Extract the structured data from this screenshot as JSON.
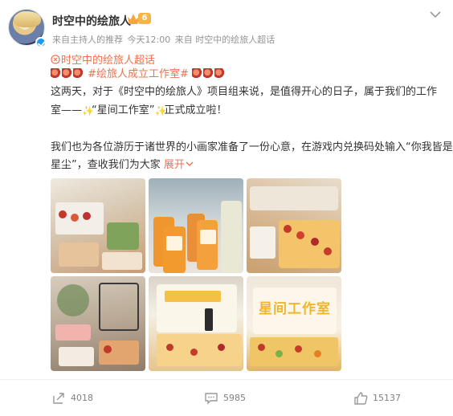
{
  "post": {
    "author": "时空中的绘旅人",
    "vip_level": "6",
    "meta": {
      "source": "来自主持人的推荐",
      "time": "今天12:00",
      "via": "来自 时空中的绘旅人超话"
    },
    "supertopic": "时空中的绘旅人超话",
    "hashtag": "#绘旅人成立工作室#",
    "lines": {
      "l1_a": "这两天，对于《时空中的绘旅人》项目组来说，是值得开心的日子，属于我们的工作",
      "l2_a": "室——",
      "l2_b": "“星间工作室”",
      "l2_c": "正式成立啦！",
      "l3": "我们也为各位游历于诸世界的小画家准备了一份心意，在游戏内兑换码处输入“你我皆是",
      "l4_a": "星尘”，查收我们为大家",
      "expand": "展开"
    },
    "images": [
      "dessert-buffet-photo-1",
      "juice-bottles-photo",
      "fruit-tarts-photo",
      "dessert-stands-photo",
      "star-cake-photo-1",
      "star-cake-photo-2"
    ],
    "cake_text": "星间工作室",
    "actions": {
      "share": "4018",
      "comment": "5985",
      "like": "15137"
    },
    "colors": {
      "accent": "#eb7350",
      "meta": "#939393"
    }
  }
}
